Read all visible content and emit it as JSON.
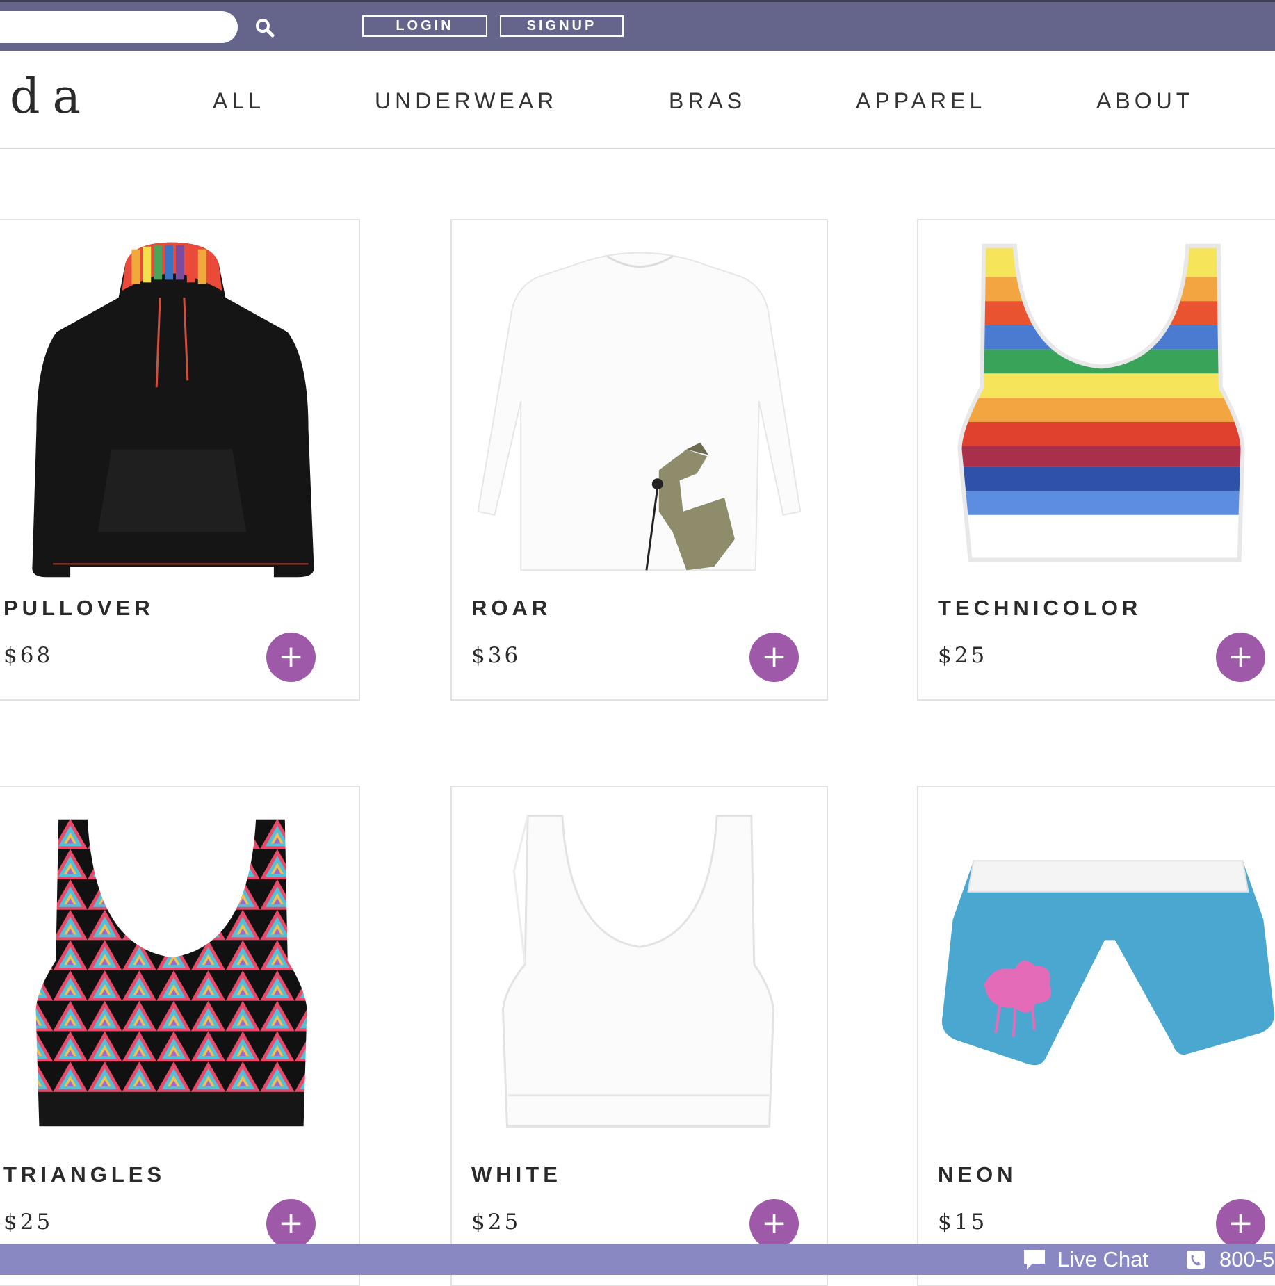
{
  "topbar": {
    "search_placeholder": "",
    "search_icon": "search-icon",
    "login_label": "LOGIN",
    "signup_label": "SIGNUP",
    "bar_color": "#65648b"
  },
  "nav": {
    "logo_text": "da",
    "items": [
      "ALL",
      "UNDERWEAR",
      "BRAS",
      "APPAREL",
      "ABOUT"
    ]
  },
  "products": [
    {
      "name": "PULLOVER",
      "price": "$68",
      "image": "black-hoodie-rainbow-hood"
    },
    {
      "name": "ROAR",
      "price": "$36",
      "image": "white-longsleeve-dinosaur-mic"
    },
    {
      "name": "TECHNICOLOR",
      "price": "$25",
      "image": "rainbow-stripe-bra"
    },
    {
      "name": "TRIANGLES",
      "price": "$25",
      "image": "triangle-pattern-bra"
    },
    {
      "name": "WHITE",
      "price": "$25",
      "image": "white-bra"
    },
    {
      "name": "NEON",
      "price": "$15",
      "image": "blue-boxer-pink-splash"
    }
  ],
  "add_label": "+",
  "accent_color": "#9e5aa8",
  "footer": {
    "chat_label": "Live Chat",
    "phone_label": "800-5",
    "bar_color": "#8a88c2"
  }
}
